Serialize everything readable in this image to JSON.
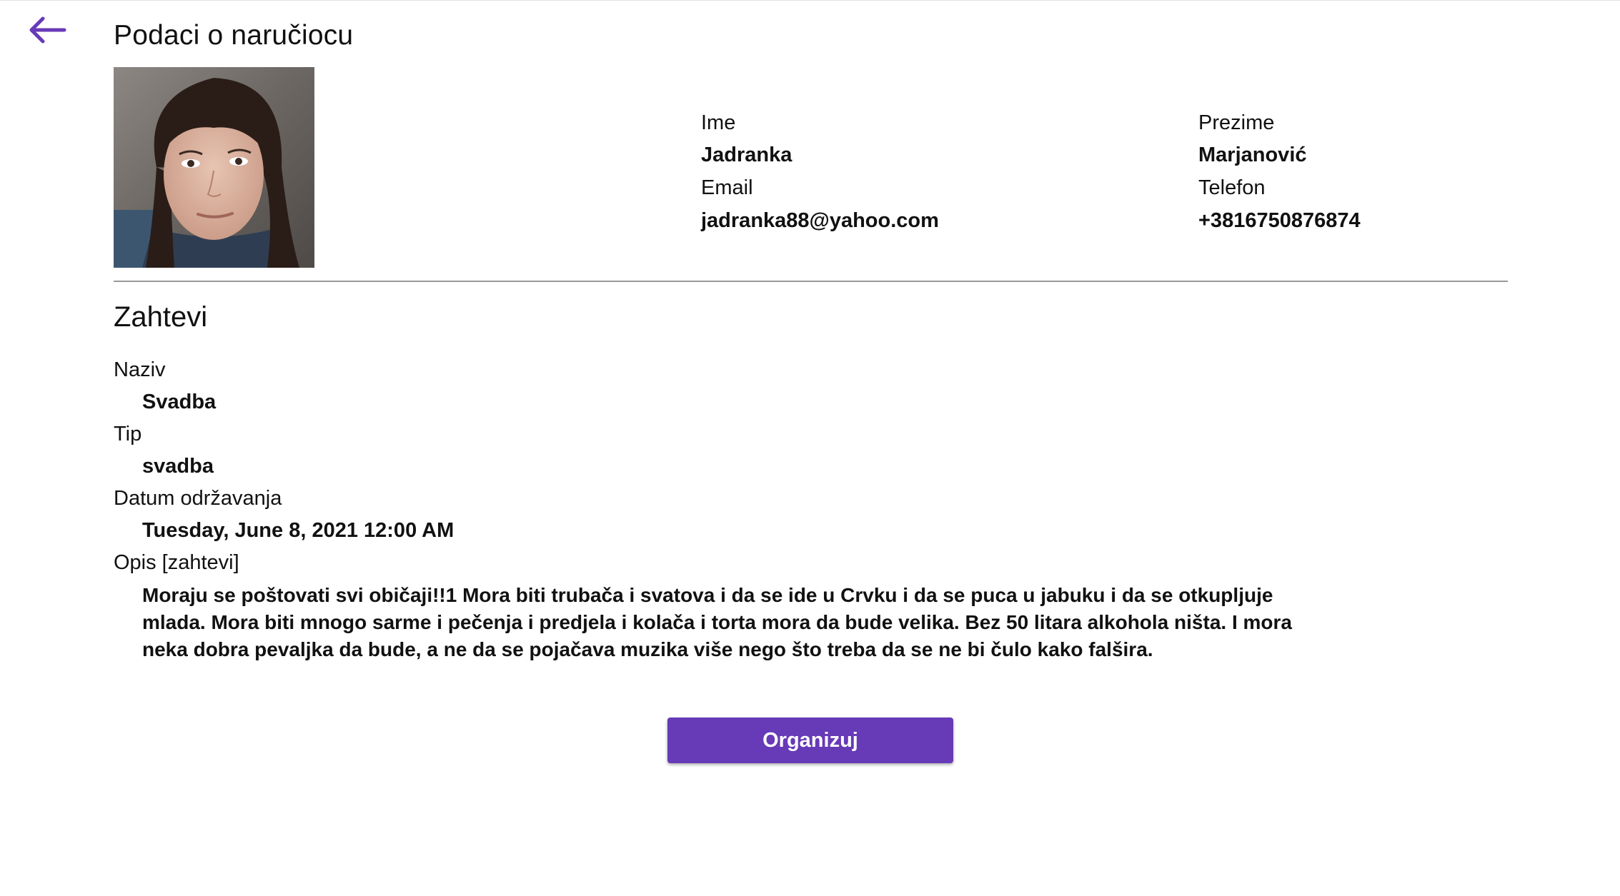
{
  "header": {
    "back_icon": "arrow-left-icon",
    "title": "Podaci o naručiocu"
  },
  "client": {
    "avatar_icon": "avatar-photo",
    "first_name_label": "Ime",
    "first_name": "Jadranka",
    "last_name_label": "Prezime",
    "last_name": "Marjanović",
    "email_label": "Email",
    "email": "jadranka88@yahoo.com",
    "phone_label": "Telefon",
    "phone": "+3816750876874"
  },
  "requests": {
    "title": "Zahtevi",
    "name_label": "Naziv",
    "name": "Svadba",
    "type_label": "Tip",
    "type": "svadba",
    "date_label": "Datum održavanja",
    "date": "Tuesday, June 8, 2021 12:00 AM",
    "description_label": "Opis [zahtevi]",
    "description": "Moraju se poštovati svi običaji!!1 Mora biti trubača i svatova i da se ide u Crvku i da se puca u jabuku i da se otkupljuje mlada. Mora biti mnogo sarme i pečenja i predjela i kolača i torta mora da bude velika. Bez 50 litara alkohola ništa. I mora neka dobra pevaljka da bude, a ne da se pojačava muzika više nego što treba da se ne bi čulo kako falšira."
  },
  "actions": {
    "organize_label": "Organizuj"
  },
  "colors": {
    "accent": "#673ab7",
    "text": "#111111",
    "divider": "#9a9a9a"
  }
}
